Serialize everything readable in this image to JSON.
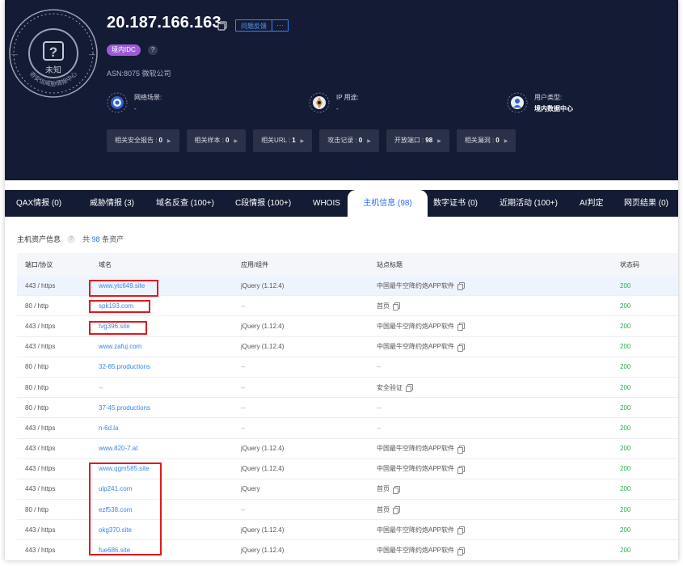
{
  "header": {
    "ip": "20.187.166.163",
    "feedback_label": "问题反馈",
    "more_label": "···",
    "idc_badge": "境内IDC",
    "help": "?",
    "asn": "ASN:8075 微软公司",
    "seal_center_text": "未知",
    "seal_ring_text": "奇安信威胁情报中心",
    "network_scene_label": "网络场景:",
    "network_scene_value": "-",
    "ip_use_label": "IP 用途:",
    "ip_use_value": "-",
    "user_type_label": "用户类型:",
    "user_type_value": "境内数据中心",
    "stats": [
      {
        "label": "相关安全报告 :",
        "value": "0"
      },
      {
        "label": "相关样本 :",
        "value": "0"
      },
      {
        "label": "相关URL :",
        "value": "1"
      },
      {
        "label": "攻击记录 :",
        "value": "0"
      },
      {
        "label": "开放端口 :",
        "value": "98"
      },
      {
        "label": "相关漏洞 :",
        "value": "0"
      }
    ]
  },
  "tabs": [
    {
      "label": "QAX情报 (0)"
    },
    {
      "label": "威胁情报 (3)"
    },
    {
      "label": "域名反查 (100+)"
    },
    {
      "label": "C段情报 (100+)"
    },
    {
      "label": "WHOIS"
    },
    {
      "label": "主机信息 (98)"
    },
    {
      "label": "数字证书 (0)"
    },
    {
      "label": "近期活动 (100+)"
    },
    {
      "label": "AI判定"
    },
    {
      "label": "网页结果 (0)"
    }
  ],
  "section": {
    "title": "主机资产信息",
    "help": "?",
    "count_prefix": "共",
    "count": "98",
    "count_suffix": "条资产"
  },
  "table": {
    "columns": [
      "端口/协议",
      "域名",
      "应用/组件",
      "站点标题",
      "状态码"
    ],
    "rows": [
      {
        "port": "443 / https",
        "domain": "www.ytc649.site",
        "app": "jQuery (1.12.4)",
        "title": "中国最牛空降约炮APP软件",
        "title_copy": true,
        "status": "200"
      },
      {
        "port": "80 / http",
        "domain": "spk193.com",
        "app": "--",
        "title": "首页",
        "title_copy": true,
        "status": "200"
      },
      {
        "port": "443 / https",
        "domain": "tvg396.site",
        "app": "jQuery (1.12.4)",
        "title": "中国最牛空降约炮APP软件",
        "title_copy": true,
        "status": "200"
      },
      {
        "port": "443 / https",
        "domain": "www.zafuj.com",
        "app": "jQuery (1.12.4)",
        "title": "中国最牛空降约炮APP软件",
        "title_copy": true,
        "status": "200"
      },
      {
        "port": "80 / http",
        "domain": "32-85.productions",
        "app": "--",
        "title": "--",
        "title_copy": false,
        "status": "200"
      },
      {
        "port": "80 / http",
        "domain": "--",
        "app": "--",
        "title": "安全验证",
        "title_copy": true,
        "status": "200"
      },
      {
        "port": "80 / http",
        "domain": "37-45.productions",
        "app": "--",
        "title": "--",
        "title_copy": false,
        "status": "200"
      },
      {
        "port": "443 / https",
        "domain": "n-6d.la",
        "app": "--",
        "title": "--",
        "title_copy": false,
        "status": "200"
      },
      {
        "port": "443 / https",
        "domain": "www.820-7.at",
        "app": "jQuery (1.12.4)",
        "title": "中国最牛空降约炮APP软件",
        "title_copy": true,
        "status": "200"
      },
      {
        "port": "443 / https",
        "domain": "www.qgm585.site",
        "app": "jQuery (1.12.4)",
        "title": "中国最牛空降约炮APP软件",
        "title_copy": true,
        "status": "200"
      },
      {
        "port": "443 / https",
        "domain": "ulp241.com",
        "app": "jQuery",
        "title": "首页",
        "title_copy": true,
        "status": "200"
      },
      {
        "port": "80 / http",
        "domain": "ezf538.com",
        "app": "--",
        "title": "首页",
        "title_copy": true,
        "status": "200"
      },
      {
        "port": "443 / https",
        "domain": "okg370.site",
        "app": "jQuery (1.12.4)",
        "title": "中国最牛空降约炮APP软件",
        "title_copy": true,
        "status": "200"
      },
      {
        "port": "443 / https",
        "domain": "fue686.site",
        "app": "jQuery (1.12.4)",
        "title": "中国最牛空降约炮APP软件",
        "title_copy": true,
        "status": "200"
      }
    ]
  },
  "colors": {
    "header_bg": "#141b34",
    "accent": "#2d6ef6",
    "status_ok": "#2fa84f",
    "annotation": "#e1191b",
    "badge": "#9d5bd8"
  }
}
